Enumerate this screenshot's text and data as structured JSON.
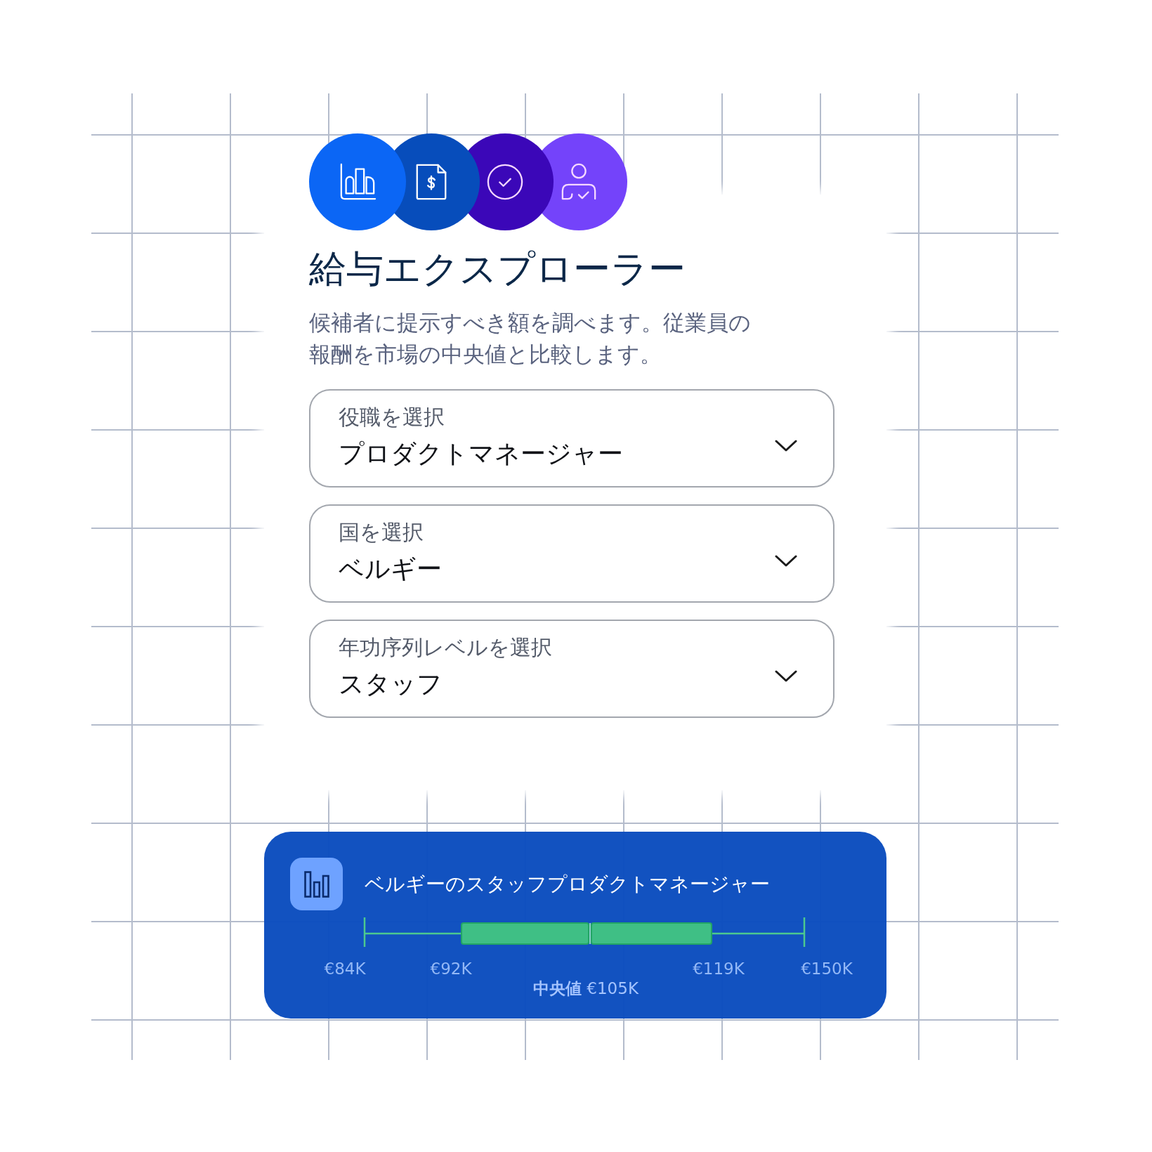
{
  "badges": [
    {
      "kind": "chart",
      "color": "#0b66f5"
    },
    {
      "kind": "invoice",
      "color": "#074dbb"
    },
    {
      "kind": "check",
      "color": "#3b07b8"
    },
    {
      "kind": "person",
      "color": "#7443fa"
    }
  ],
  "title": "給与エクスプローラー",
  "description": "候補者に提示すべき額を調べます。従業員の報酬を市場の中央値と比較します。",
  "selects": [
    {
      "label": "役職を選択",
      "value": "プロダクトマネージャー"
    },
    {
      "label": "国を選択",
      "value": "ベルギー"
    },
    {
      "label": "年功序列レベルを選択",
      "value": "スタッフ"
    }
  ],
  "result": {
    "title": "ベルギーのスタッフプロダクトマネージャー",
    "range_labels": [
      "€84K",
      "€92K",
      "€119K",
      "€150K"
    ],
    "median_label": "**中央値** €105K"
  }
}
